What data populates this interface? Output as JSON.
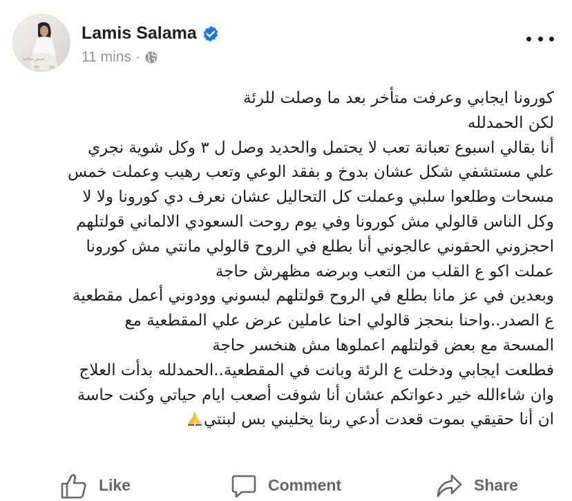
{
  "post": {
    "author": "Lamis Salama",
    "time": "11 mins",
    "separator": "·",
    "avatar_caption": "لميس سلامة",
    "body_lines": [
      "كورونا ايجابي وعرفت متأخر بعد ما وصلت للرئة",
      "لكن الحمدلله",
      "أنا بقالي اسبوع تعبانة تعب لا يحتمل والحديد وصل ل ٣ وكل شوية نجري",
      "علي مستشفي شكل عشان بدوخ و بفقد الوعي وتعب رهيب وعملت خمس",
      "مسحات وطلعوا سلبي وعملت كل التحاليل عشان نعرف دي كورونا ولا لا",
      "وكل الناس قالولي مش كورونا وفي يوم روحت السعودي الالماني قولتلهم",
      "احجزوني الحقوني عالجوني أنا بطلع في الروح قالولي مانتي مش كورونا",
      "عملت اكو ع القلب من التعب وبرضه مظهرش حاجة",
      "وبعدين في عز مانا بطلع في الروح قولتلهم لبسوني وودوني أعمل مقطعية",
      "ع الصدر..واحنا بنحجز قالولي احنا عاملين عرض علي المقطعية مع",
      "المسحة مع بعض قولتلهم اعملوها مش هنخسر حاجة",
      "فطلعت ايجابي ودخلت ع الرئة وبانت في المقطعية..الحمدلله بدأت العلاج",
      "وان شاءالله خير دعواتكم عشان أنا شوفت أصعب ايام حياتي وكنت حاسة",
      "ان أنا حقيقي بموت قعدت أدعي ربنا يخليني بس لبنتي"
    ]
  },
  "actions": {
    "like": "Like",
    "comment": "Comment",
    "share": "Share"
  },
  "icons": {
    "verified": "verified-badge-icon",
    "globe": "globe-icon",
    "more": "more-options-icon",
    "pray": "folded-hands-emoji",
    "like": "thumbs-up-icon",
    "comment": "comment-bubble-icon",
    "share": "share-arrow-icon"
  },
  "colors": {
    "verified": "#1877f2",
    "text": "#1c1e21",
    "meta": "#90949c",
    "action": "#606770"
  }
}
